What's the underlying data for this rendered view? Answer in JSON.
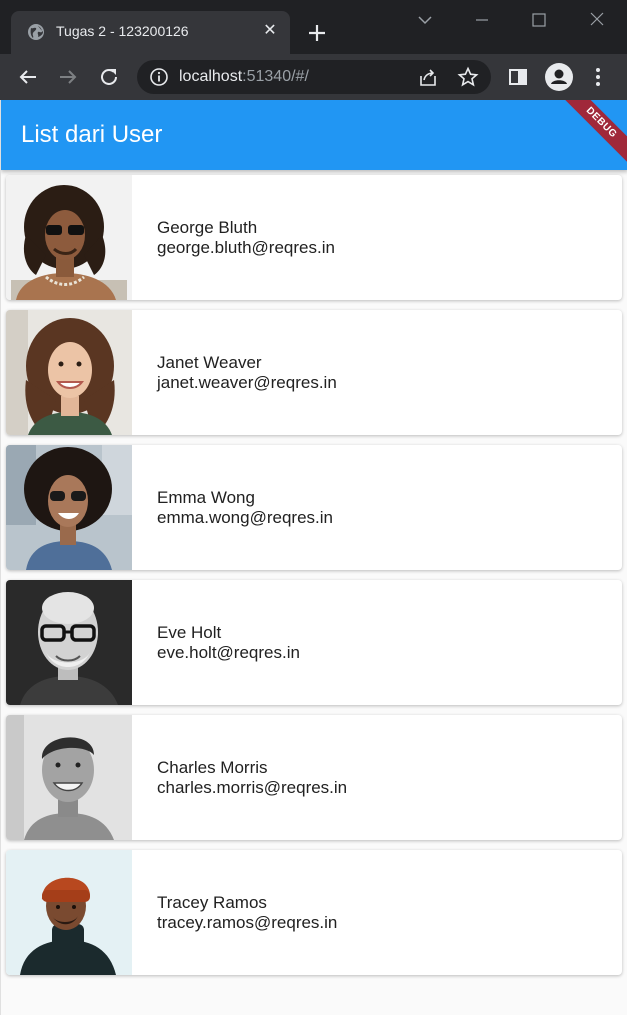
{
  "browser": {
    "tab_title": "Tugas 2 - 123200126",
    "tab_close": "✕",
    "url_host": "localhost",
    "url_rest": ":51340/#/"
  },
  "app": {
    "title": "List dari User",
    "debug_label": "DEBUG",
    "accent_color": "#2196f3"
  },
  "users": [
    {
      "name": "George Bluth",
      "email": "george.bluth@reqres.in",
      "photo": "avatar-george"
    },
    {
      "name": "Janet Weaver",
      "email": "janet.weaver@reqres.in",
      "photo": "avatar-janet"
    },
    {
      "name": "Emma Wong",
      "email": "emma.wong@reqres.in",
      "photo": "avatar-emma"
    },
    {
      "name": "Eve Holt",
      "email": "eve.holt@reqres.in",
      "photo": "avatar-eve"
    },
    {
      "name": "Charles Morris",
      "email": "charles.morris@reqres.in",
      "photo": "avatar-charles"
    },
    {
      "name": "Tracey Ramos",
      "email": "tracey.ramos@reqres.in",
      "photo": "avatar-tracey"
    }
  ]
}
